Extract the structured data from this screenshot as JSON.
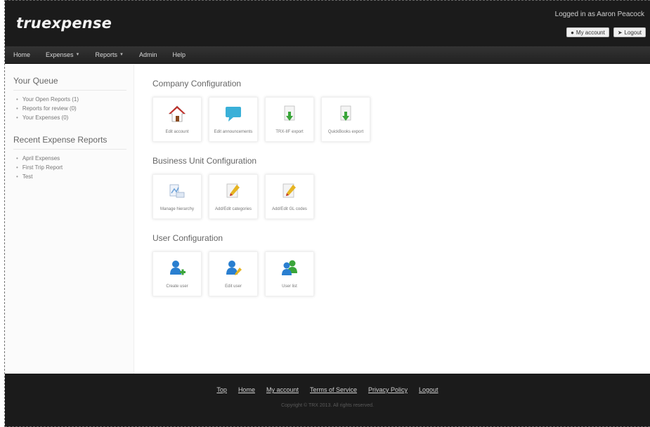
{
  "header": {
    "logo": "truexpense",
    "logged_in": "Logged in as Aaron Peacock",
    "my_account": "My account",
    "logout": "Logout"
  },
  "navbar": {
    "home": "Home",
    "expenses": "Expenses",
    "reports": "Reports",
    "admin": "Admin",
    "help": "Help"
  },
  "sidebar": {
    "queue_title": "Your Queue",
    "queue_items": [
      "Your Open Reports (1)",
      "Reports for review (0)",
      "Your Expenses (0)"
    ],
    "recent_title": "Recent Expense Reports",
    "recent_items": [
      "April Expenses",
      "First Trip Report",
      "Test"
    ]
  },
  "main": {
    "company_title": "Company Configuration",
    "company_tiles": [
      {
        "label": "Edit account",
        "icon": "house-icon"
      },
      {
        "label": "Edit announcements",
        "icon": "speech-bubble-icon"
      },
      {
        "label": "TRX-IIF export",
        "icon": "download-document-icon"
      },
      {
        "label": "QuickBooks export",
        "icon": "download-document-icon"
      }
    ],
    "business_title": "Business Unit Configuration",
    "business_tiles": [
      {
        "label": "Manage hierarchy",
        "icon": "hierarchy-icon"
      },
      {
        "label": "Add/Edit categories",
        "icon": "edit-document-icon"
      },
      {
        "label": "Add/Edit GL codes",
        "icon": "edit-document-icon"
      }
    ],
    "user_title": "User Configuration",
    "user_tiles": [
      {
        "label": "Create user",
        "icon": "add-user-icon"
      },
      {
        "label": "Edit user",
        "icon": "edit-user-icon"
      },
      {
        "label": "User list",
        "icon": "users-icon"
      }
    ]
  },
  "footer": {
    "links": [
      "Top",
      "Home",
      "My account",
      "Terms of Service",
      "Privacy Policy",
      "Logout"
    ],
    "copyright": "Copyright © TRX 2013. All rights reserved."
  },
  "colors": {
    "header_bg": "#1b1b1b",
    "accent_blue": "#2a7fd0",
    "accent_green": "#3aa53a",
    "accent_red": "#c0312b"
  }
}
